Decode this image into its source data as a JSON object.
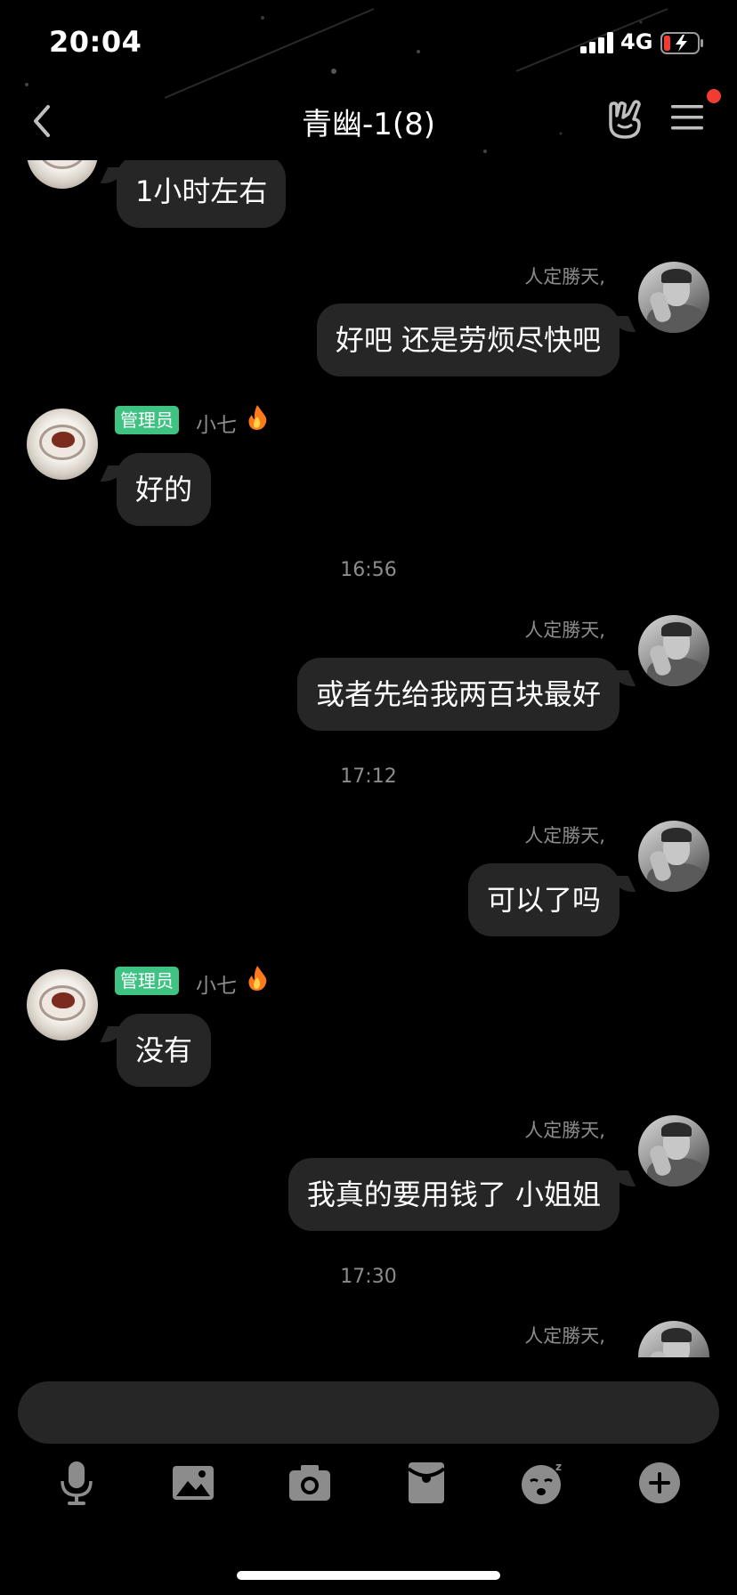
{
  "status_bar": {
    "time": "20:04",
    "network": "4G"
  },
  "nav": {
    "title": "青幽-1(8)"
  },
  "messages": [
    {
      "text": "1小时左右"
    },
    {
      "sender": "人定勝天,",
      "text": "好吧  还是劳烦尽快吧"
    },
    {
      "badge": "管理员",
      "sender": "小七",
      "text": "好的"
    },
    {
      "time": "16:56"
    },
    {
      "sender": "人定勝天,",
      "text": "或者先给我两百块最好"
    },
    {
      "time": "17:12"
    },
    {
      "sender": "人定勝天,",
      "text": "可以了吗"
    },
    {
      "badge": "管理员",
      "sender": "小七",
      "text": "没有"
    },
    {
      "sender": "人定勝天,",
      "text": "我真的要用钱了  小姐姐"
    },
    {
      "time": "17:30"
    },
    {
      "sender": "人定勝天,"
    }
  ],
  "colors": {
    "badge": "#3fc383",
    "bubble": "#262626",
    "notification_dot": "#f23b33"
  },
  "icons": {
    "nav": [
      "back-chevron-icon",
      "hand-gesture-icon",
      "menu-icon"
    ],
    "toolbar": [
      "microphone-icon",
      "image-icon",
      "camera-icon",
      "red-packet-icon",
      "emoji-icon",
      "plus-icon"
    ]
  }
}
